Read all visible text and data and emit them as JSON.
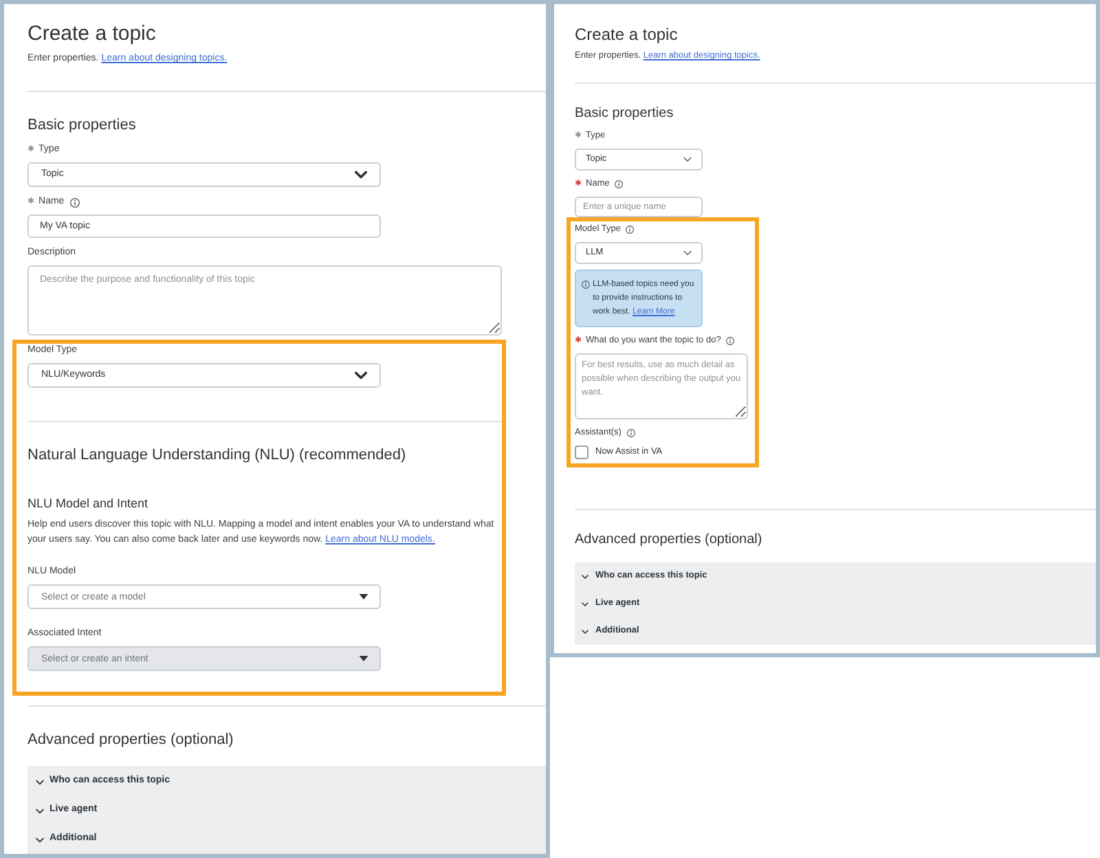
{
  "panels": [
    {
      "title": "Create a topic",
      "intro": "Enter properties.",
      "intro_link": "Learn about designing topics.",
      "groups": [
        {
          "highlighted": false,
          "items": [
            {
              "kind": "divider"
            },
            {
              "kind": "heading",
              "text": "Basic properties"
            },
            {
              "kind": "select",
              "required_mark": "✱",
              "label": "Type",
              "value": "Topic",
              "disabled": false
            },
            {
              "kind": "input",
              "required_mark": "✱",
              "label": "Name",
              "info": true,
              "value": "My VA topic",
              "disabled": false
            },
            {
              "kind": "textarea",
              "label": "Description",
              "placeholder": "Describe the purpose and functionality of this topic",
              "disabled": false
            }
          ]
        },
        {
          "highlighted": true,
          "items": [
            {
              "kind": "select",
              "label": "Model Type",
              "value": "NLU/Keywords",
              "disabled": false
            },
            {
              "kind": "divider"
            },
            {
              "kind": "heading",
              "text": "Natural Language Understanding (NLU) (recommended)"
            },
            {
              "kind": "subheading",
              "text": "NLU Model and Intent"
            },
            {
              "kind": "paragraph",
              "text": "Help end users discover this topic with NLU. Mapping a model and intent enables your VA to understand what your users say. You can also come back later and use keywords now.",
              "link": "Learn about NLU models."
            },
            {
              "kind": "lookup",
              "label": "NLU Model",
              "placeholder": "Select or create a model",
              "disabled": false
            },
            {
              "kind": "lookup",
              "label": "Associated Intent",
              "placeholder": "Select or create an intent",
              "disabled": true
            }
          ]
        },
        {
          "highlighted": false,
          "items": [
            {
              "kind": "divider"
            },
            {
              "kind": "heading",
              "text": "Advanced properties (optional)"
            },
            {
              "kind": "accordion",
              "sections": [
                {
                  "label": "Who can access this topic",
                  "expanded": false
                },
                {
                  "label": "Live agent",
                  "expanded": false
                },
                {
                  "label": "Additional",
                  "expanded": false
                }
              ]
            }
          ]
        }
      ]
    },
    {
      "title": "Create a topic",
      "intro": "Enter properties.",
      "intro_link": "Learn about designing topics.",
      "groups": [
        {
          "highlighted": false,
          "items": [
            {
              "kind": "divider"
            },
            {
              "kind": "heading",
              "text": "Basic properties"
            },
            {
              "kind": "select",
              "required_mark": "✱",
              "label": "Type",
              "value": "Topic",
              "disabled": false
            },
            {
              "kind": "input",
              "required_mark": "✱",
              "label": "Name",
              "info": true,
              "placeholder": "Enter a unique name",
              "disabled": false
            }
          ]
        },
        {
          "highlighted": true,
          "items": [
            {
              "kind": "select",
              "label": "Model Type",
              "info": true,
              "value": "LLM",
              "disabled": false
            },
            {
              "kind": "notice",
              "text": "LLM-based topics need you to provide instructions to work best.",
              "link": "Learn More"
            },
            {
              "kind": "textarea",
              "required_mark": "✱",
              "label": "What do you want the topic to do?",
              "info": true,
              "placeholder": "For best results, use as much detail as possible when describing the output you want.",
              "disabled": false
            },
            {
              "kind": "checkbox_group",
              "label": "Assistant(s)",
              "info": true,
              "options": [
                {
                  "label": "Now Assist in VA",
                  "checked": false
                }
              ]
            }
          ]
        },
        {
          "highlighted": false,
          "items": [
            {
              "kind": "divider"
            },
            {
              "kind": "heading",
              "text": "Advanced properties (optional)"
            },
            {
              "kind": "accordion",
              "sections": [
                {
                  "label": "Who can access this topic",
                  "expanded": false
                },
                {
                  "label": "Live agent",
                  "expanded": false
                },
                {
                  "label": "Additional",
                  "expanded": false
                }
              ]
            }
          ]
        }
      ]
    }
  ]
}
